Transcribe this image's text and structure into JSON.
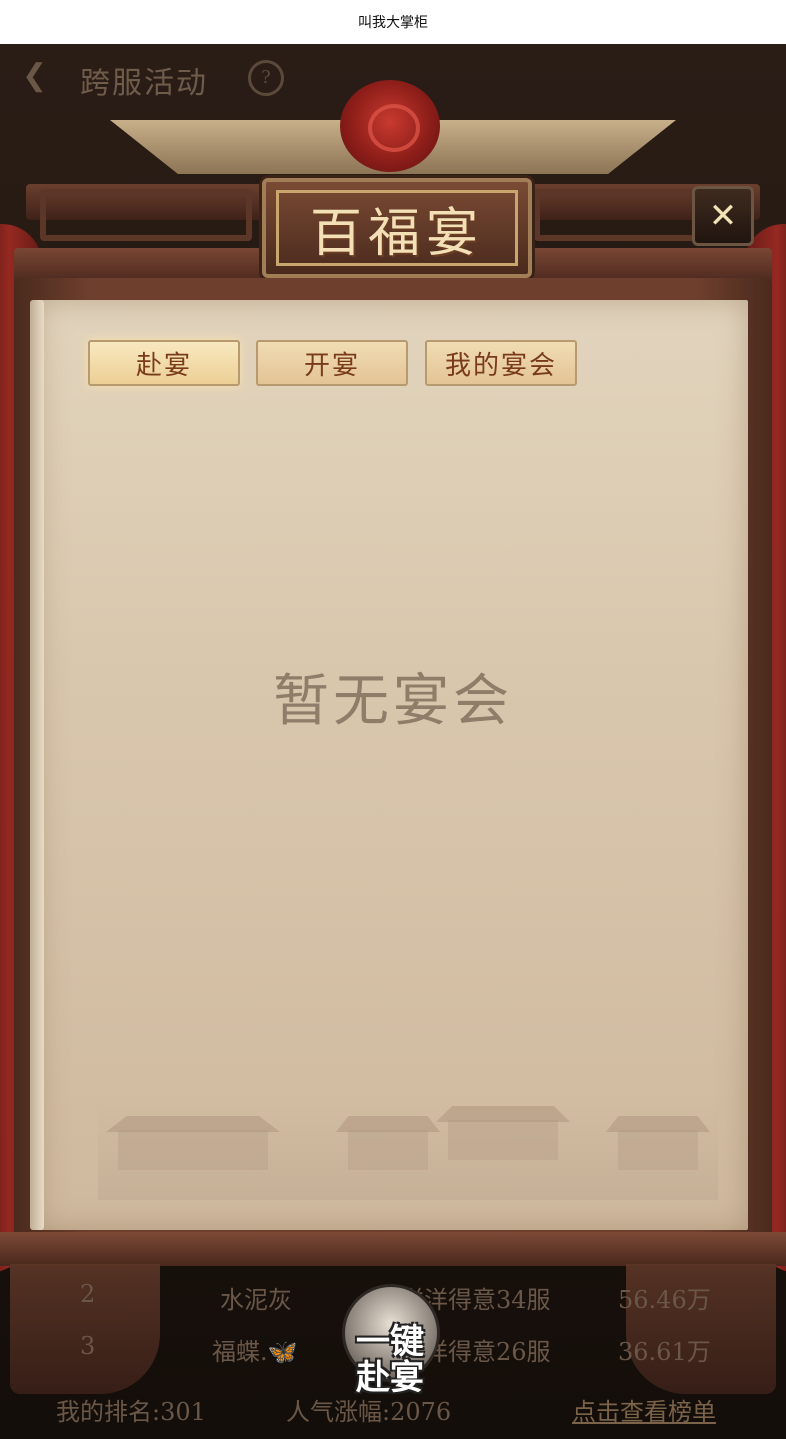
{
  "topbar": {
    "title": "叫我大掌柜"
  },
  "background": {
    "back_icon": "chevron-left-icon",
    "header_title": "跨服活动",
    "help_icon_text": "?",
    "rows": [
      {
        "rank": "2",
        "name": "水泥灰",
        "server": "洋洋得意34服",
        "value": "56.46万"
      },
      {
        "rank": "3",
        "name": "福蝶.🦋",
        "server": "洋洋得意26服",
        "value": "36.61万"
      }
    ],
    "my_rank": "我的排名:301",
    "popularity": "人气涨幅:2076",
    "view_rank_link": "点击查看榜单"
  },
  "modal": {
    "title": "百福宴",
    "close_icon": "close-icon",
    "close_text": "✕",
    "tabs": [
      {
        "label": "赴宴",
        "active": true
      },
      {
        "label": "开宴",
        "active": false
      },
      {
        "label": "我的宴会",
        "active": false
      }
    ],
    "empty_message": "暂无宴会"
  },
  "feast_button": {
    "label_line1": "一键",
    "label_line2": "赴宴"
  }
}
